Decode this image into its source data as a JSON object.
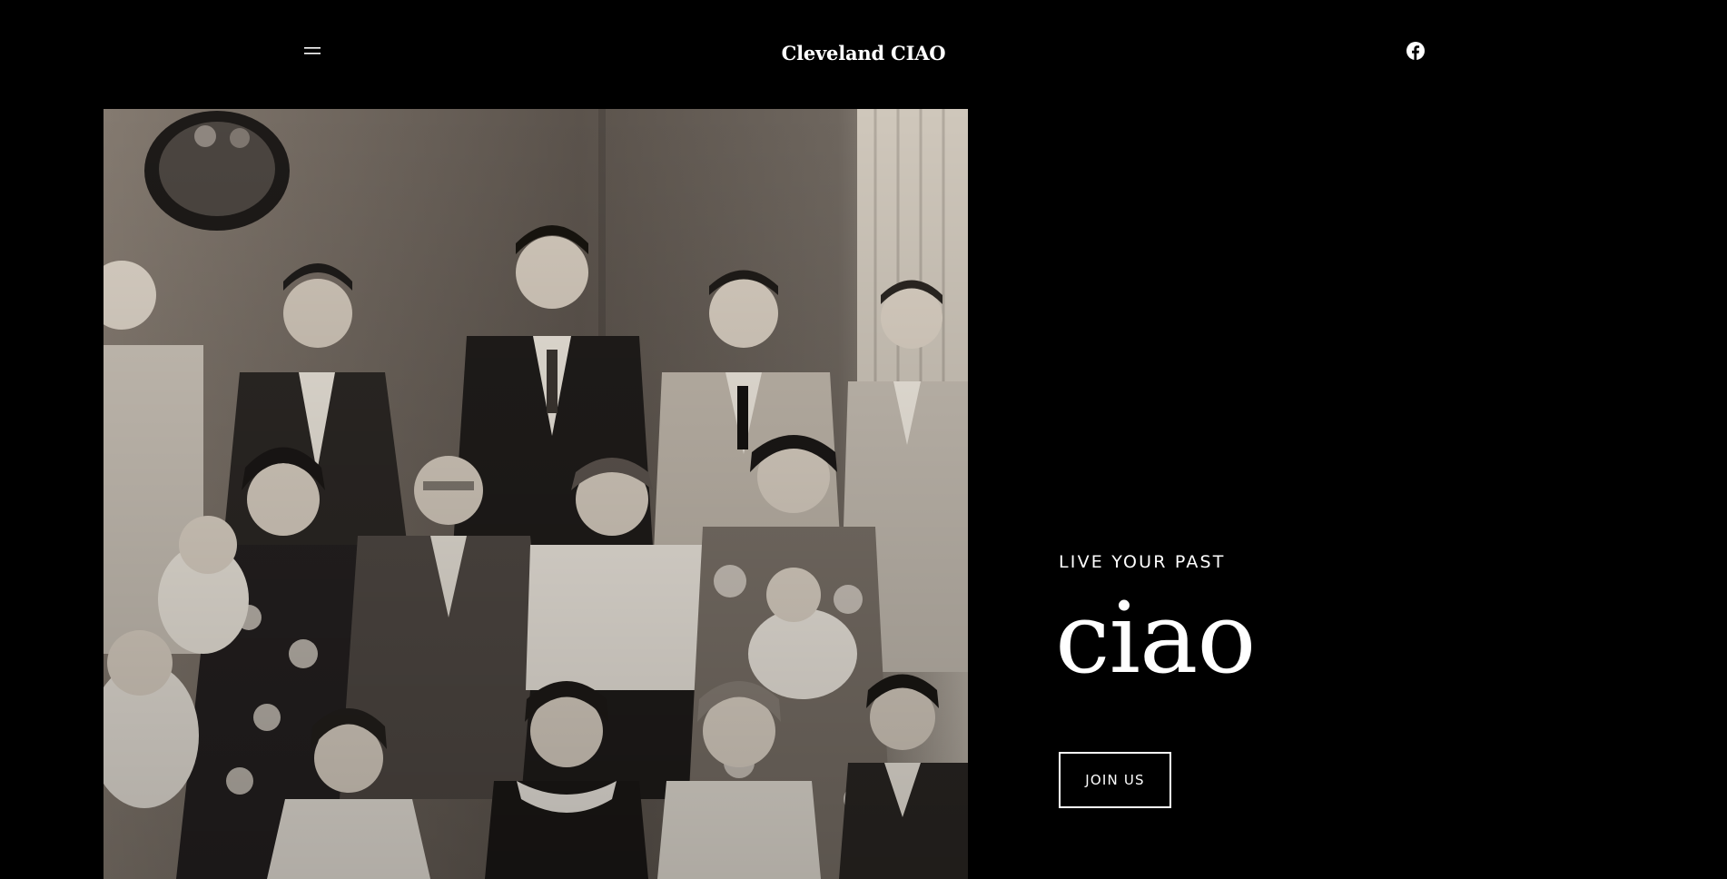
{
  "header": {
    "site_title": "Cleveland CIAO",
    "menu_icon": "hamburger-icon",
    "social_icon": "facebook-icon"
  },
  "hero": {
    "photo_description_icon": "family-photo",
    "eyebrow": "LIVE YOUR PAST",
    "heading": "ciao",
    "cta_label": "JOIN US"
  },
  "colors": {
    "background": "#000000",
    "text": "#ffffff",
    "photo_tone": "#6f655c"
  }
}
